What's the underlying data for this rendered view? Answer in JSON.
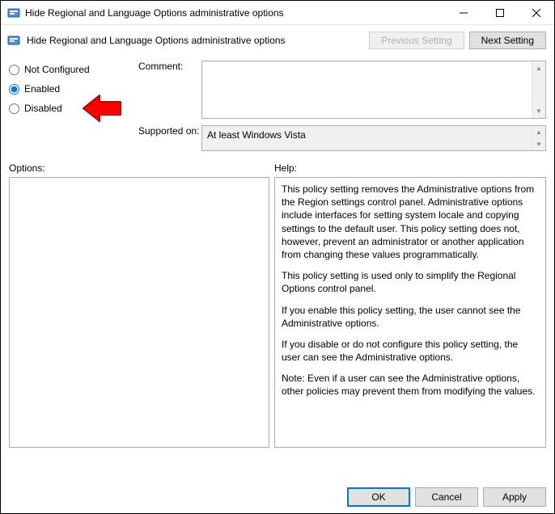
{
  "titlebar": {
    "title": "Hide Regional and Language Options administrative options"
  },
  "header": {
    "subtitle": "Hide Regional and Language Options administrative options",
    "prev_label": "Previous Setting",
    "next_label": "Next Setting"
  },
  "state": {
    "selected": "Enabled",
    "options": {
      "not_configured": "Not Configured",
      "enabled": "Enabled",
      "disabled": "Disabled"
    }
  },
  "labels": {
    "comment": "Comment:",
    "supported_on": "Supported on:",
    "options": "Options:",
    "help": "Help:"
  },
  "fields": {
    "comment_value": "",
    "supported_on_value": "At least Windows Vista"
  },
  "help": {
    "p1": "This policy setting removes the Administrative options from the Region settings control panel.  Administrative options include interfaces for setting system locale and copying settings to the default user. This policy setting does not, however, prevent an administrator or another application from changing these values programmatically.",
    "p2": "This policy setting is used only to simplify the Regional Options control panel.",
    "p3": "If you enable this policy setting, the user cannot see the Administrative options.",
    "p4": "If you disable or do not configure this policy setting, the user can see the Administrative options.",
    "p5": "Note: Even if a user can see the Administrative options, other policies may prevent them from modifying the values."
  },
  "footer": {
    "ok": "OK",
    "cancel": "Cancel",
    "apply": "Apply"
  }
}
